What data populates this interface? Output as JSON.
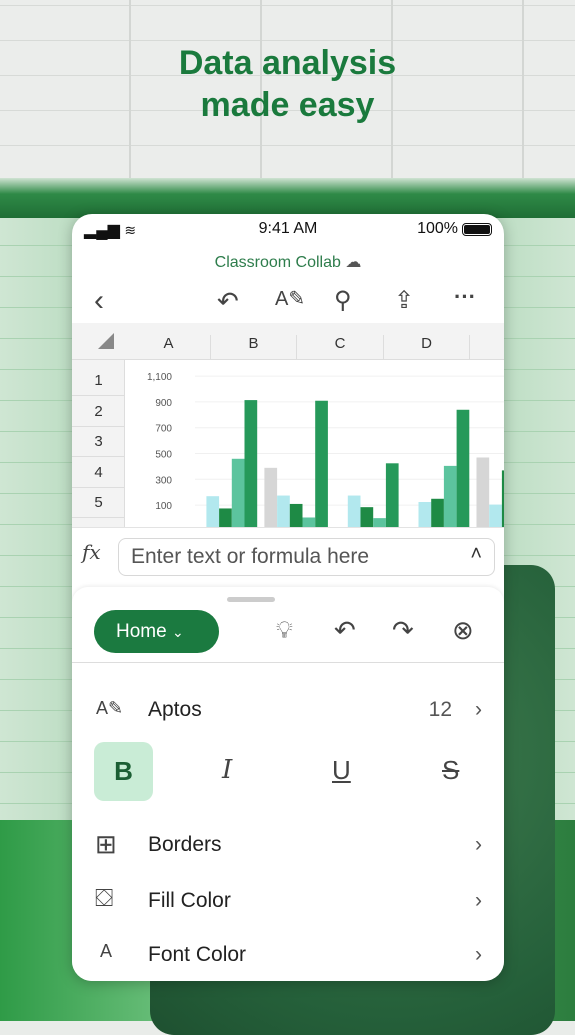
{
  "headline": {
    "line1": "Data analysis",
    "line2": "made easy"
  },
  "status_bar": {
    "time": "9:41 AM",
    "battery": "100%"
  },
  "document": {
    "title": "Classroom Collab"
  },
  "toolbar": {
    "icons": [
      "back-icon",
      "undo-icon",
      "draw-icon",
      "search-icon",
      "share-icon",
      "more-icon"
    ]
  },
  "grid": {
    "columns": [
      "A",
      "B",
      "C",
      "D"
    ],
    "rows": [
      "1",
      "2",
      "3",
      "4",
      "5"
    ]
  },
  "formula_bar": {
    "label": "fx",
    "placeholder": "Enter text or formula here"
  },
  "ribbon": {
    "tab": "Home",
    "font_name": "Aptos",
    "font_size": "12",
    "bold": "B",
    "items": [
      "Borders",
      "Fill Color",
      "Font Color"
    ]
  },
  "colors": {
    "accent": "#1b7a40",
    "bold_active_bg": "#c9ecd6"
  },
  "chart_data": {
    "type": "bar",
    "y_ticks": [
      "100",
      "300",
      "500",
      "700",
      "900",
      "1,100"
    ],
    "ylim": [
      0,
      1100
    ],
    "grid": true,
    "series": [
      {
        "color": "#d6d6d6",
        "values": [
          null,
          420,
          null,
          null,
          500
        ]
      },
      {
        "color": "#b2e8ee",
        "values": [
          200,
          205,
          205,
          155,
          135
        ]
      },
      {
        "color": "#1e8a45",
        "values": [
          105,
          140,
          115,
          180,
          400
        ]
      },
      {
        "color": "#5cc49e",
        "values": [
          490,
          35,
          30,
          435,
          null
        ]
      },
      {
        "color": "#26995a",
        "values": [
          945,
          940,
          455,
          870,
          null
        ]
      }
    ]
  }
}
